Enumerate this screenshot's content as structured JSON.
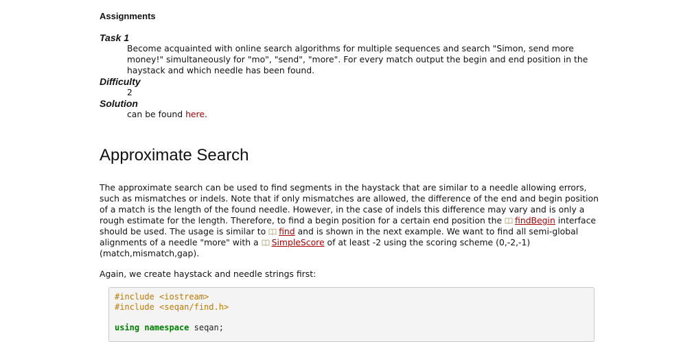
{
  "assignments": {
    "heading": "Assignments",
    "task_term": "Task 1",
    "task_text": "Become acquainted with online search algorithms for multiple sequences and search \"Simon, send more money!\" simultaneously for \"mo\", \"send\", \"more\". For every match output the begin and end position in the haystack and which needle has been found.",
    "difficulty_term": "Difficulty",
    "difficulty_value": "2",
    "solution_term": "Solution",
    "solution_prefix": "can be found ",
    "solution_link": "here",
    "solution_suffix": "."
  },
  "section": {
    "title": "Approximate Search"
  },
  "paragraph1": {
    "part1": "The approximate search can be used to find segments in the haystack that are similar to a needle allowing errors, such as mismatches or indels. Note that if only mismatches are allowed, the difference of the end and begin position of a match is the length of the found needle. However, in the case of indels this difference may vary and is only a rough estimate for the length. Therefore, to find a begin position for a certain end position the ",
    "ref1": "findBegin",
    "part2": " interface should be used. The usage is similar to ",
    "ref2": "find",
    "part3": " and is shown in the next example. We want to find all semi-global alignments of a needle \"more\" with a ",
    "ref3": "SimpleScore",
    "part4": " of at least -2 using the scoring scheme (0,-2,-1) (match,mismatch,gap)."
  },
  "paragraph2": {
    "text": "Again, we create haystack and needle strings first:"
  },
  "code": {
    "line1": "#include <iostream>",
    "line2": "#include <seqan/find.h>",
    "line3": "",
    "line4_kw1": "using",
    "line4_kw2": "namespace",
    "line4_rest": " seqan;"
  },
  "colors": {
    "link": "#aa0000",
    "preprocessor": "#bc7a00",
    "keyword": "#008000",
    "code_background": "#f4f4f4"
  },
  "icons": {
    "reference": "book-icon"
  }
}
